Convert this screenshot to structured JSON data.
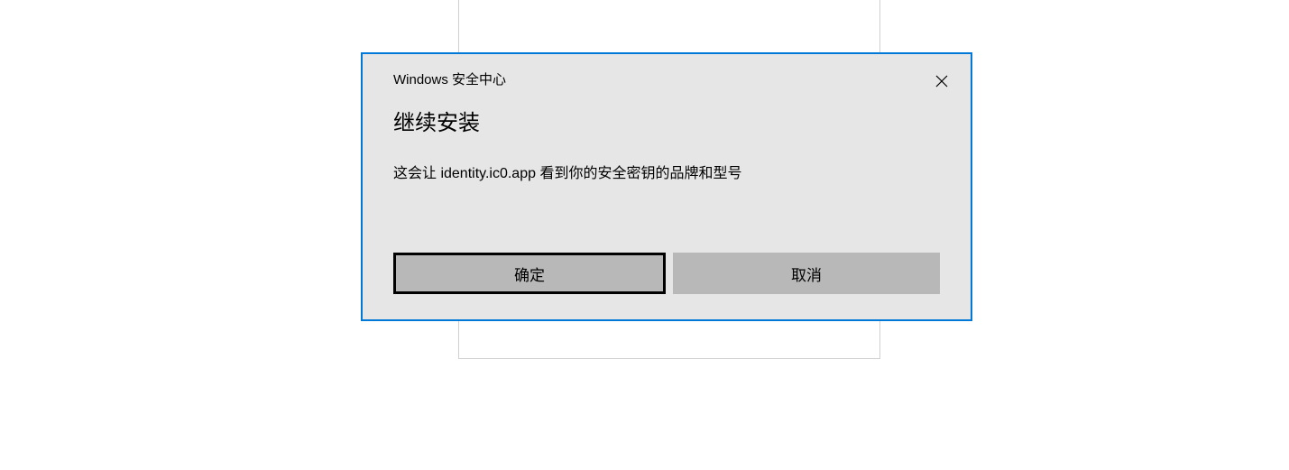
{
  "dialog": {
    "source": "Windows 安全中心",
    "title": "继续安装",
    "message": "这会让 identity.ic0.app 看到你的安全密钥的品牌和型号",
    "buttons": {
      "ok": "确定",
      "cancel": "取消"
    }
  }
}
